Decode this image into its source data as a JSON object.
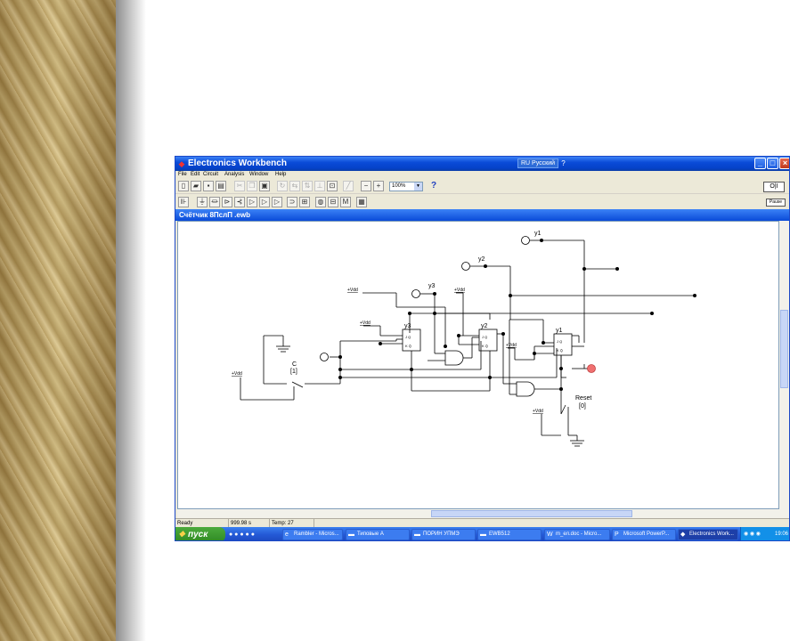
{
  "window": {
    "title": "Electronics Workbench",
    "language_indicator": "RU Русский",
    "help_badge": "?",
    "minimize_icon": "minimize-icon",
    "maximize_icon": "maximize-icon",
    "close_icon": "close-icon"
  },
  "menu": [
    "File",
    "Edit",
    "Circuit",
    "Analysis",
    "Window",
    "Help"
  ],
  "toolbar": {
    "zoom": "100%",
    "help": "?",
    "power": "O|I",
    "pause": "Pause"
  },
  "document": {
    "title": "Счётчик 8ПслП .ewb"
  },
  "circuit": {
    "labels": {
      "y1_out": "y1",
      "y2_out": "y2",
      "y3_out": "y3",
      "ff_y3": "y3",
      "ff_y2": "y2",
      "ff_y1": "y1",
      "vdd1": "+Vdd",
      "vdd2": "+Vdd",
      "vdd3": "+Vdd",
      "vdd4": "+Vdd",
      "vdd5": "+Vdd",
      "vdd6": "+Vdd",
      "clock_sw": "C",
      "clock_key": "[1]",
      "reset_sw": "Reset",
      "reset_key": "[0]"
    }
  },
  "status": {
    "state": "Ready",
    "time": "999.98 s",
    "temp": "Temp:  27"
  },
  "taskbar": {
    "start": "пуск",
    "tasks": [
      "Rambler - Micros...",
      "Типовые А",
      "ПОРИН УПМЭ",
      "EWB512",
      "m_ел.doc - Micro...",
      "Microsoft PowerP...",
      "Electronics Work..."
    ],
    "clock": "19:06"
  }
}
